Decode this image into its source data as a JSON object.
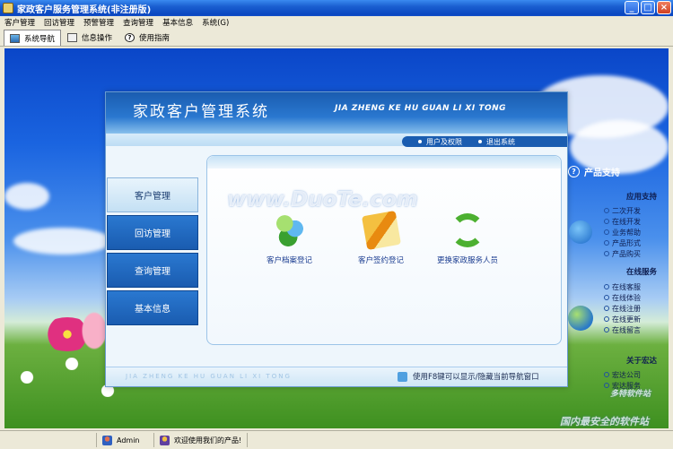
{
  "window": {
    "title": "家政客户服务管理系统(非注册版)",
    "buttons": [
      "_",
      "□",
      "×"
    ]
  },
  "menu": [
    "客户管理",
    "回访管理",
    "预警管理",
    "查询管理",
    "基本信息",
    "系统(G)"
  ],
  "toolbar": {
    "tabs": [
      {
        "label": "系统导航",
        "icon": "navigation-icon"
      },
      {
        "label": "信息操作",
        "icon": "info-icon"
      },
      {
        "label": "使用指南",
        "icon": "help-icon"
      }
    ]
  },
  "panel": {
    "title": "家政客户管理系统",
    "subtitle": "JIA ZHENG KE HU GUAN LI XI TONG",
    "links": [
      "用户及权限",
      "退出系统"
    ],
    "nav": [
      "客户管理",
      "回访管理",
      "查询管理",
      "基本信息"
    ],
    "functions": [
      "客户档案登记",
      "客户签约登记",
      "更换家政服务人员"
    ],
    "footer_pinyin": "JIA ZHENG KE HU GUAN LI XI TONG",
    "footer_tip": "使用F8键可以显示/隐藏当前导航窗口"
  },
  "support": {
    "title": "产品支持",
    "sections": [
      {
        "head": "应用支持",
        "items": [
          "二次开发",
          "在线开发",
          "业务帮助",
          "产品形式",
          "产品购买"
        ]
      },
      {
        "head": "在线服务",
        "items": [
          "在线客服",
          "在线体验",
          "在线注册",
          "在线更新",
          "在线留言"
        ]
      },
      {
        "head": "关于宏达",
        "items": [
          "宏达公司",
          "宏达服务"
        ]
      }
    ]
  },
  "watermarks": {
    "center": "www.DuoTe.com",
    "corner_top": "多特软件站",
    "corner_bottom": "国内最安全的软件站"
  },
  "status": {
    "user": "Admin",
    "welcome": "欢迎使用我们的产品!"
  }
}
